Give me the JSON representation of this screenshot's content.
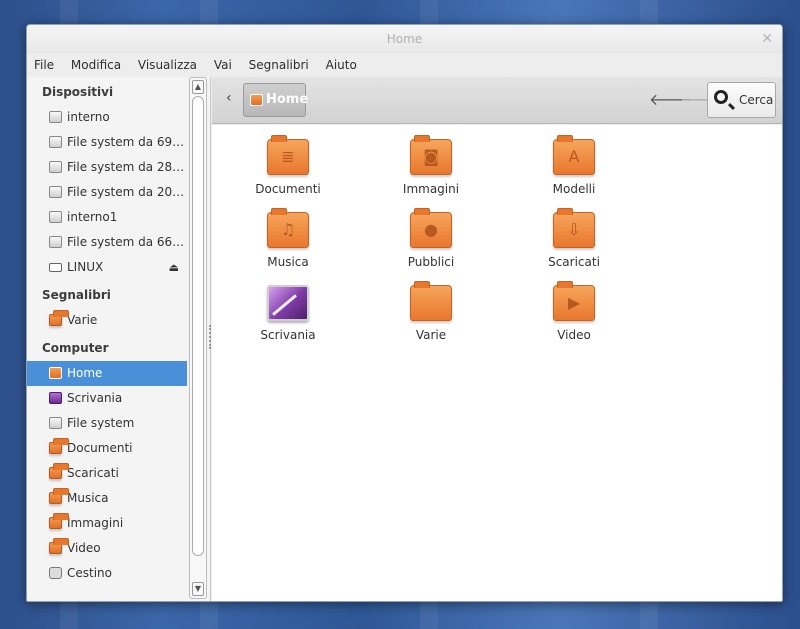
{
  "window": {
    "title": "Home"
  },
  "menu": [
    "File",
    "Modifica",
    "Visualizza",
    "Vai",
    "Segnalibri",
    "Aiuto"
  ],
  "sidebar": {
    "devices_title": "Dispositivi",
    "devices": [
      {
        "label": "interno",
        "icon": "drive-icon"
      },
      {
        "label": "File system da 69 ...",
        "icon": "drive-icon"
      },
      {
        "label": "File system da 28 ...",
        "icon": "drive-icon"
      },
      {
        "label": "File system da 20 ...",
        "icon": "drive-icon"
      },
      {
        "label": "interno1",
        "icon": "drive-icon"
      },
      {
        "label": "File system da 66 ...",
        "icon": "drive-icon"
      },
      {
        "label": "LINUX",
        "icon": "laptop-icon",
        "eject": "⏏"
      }
    ],
    "bookmarks_title": "Segnalibri",
    "bookmarks": [
      {
        "label": "Varie",
        "icon": "folder-icon"
      }
    ],
    "computer_title": "Computer",
    "computer": [
      {
        "label": "Home",
        "icon": "home-icon"
      },
      {
        "label": "Scrivania",
        "icon": "desktop-icon"
      },
      {
        "label": "File system",
        "icon": "drive-icon"
      },
      {
        "label": "Documenti",
        "icon": "folder-icon"
      },
      {
        "label": "Scaricati",
        "icon": "folder-icon"
      },
      {
        "label": "Musica",
        "icon": "folder-icon"
      },
      {
        "label": "Immagini",
        "icon": "folder-icon"
      },
      {
        "label": "Video",
        "icon": "folder-icon"
      },
      {
        "label": "Cestino",
        "icon": "trash-icon"
      }
    ]
  },
  "toolbar": {
    "back": "‹",
    "location": "Home",
    "prev": "🡐",
    "next": "🡒",
    "search_label": "Cerca"
  },
  "files": [
    {
      "label": "Documenti",
      "emblem": "≣"
    },
    {
      "label": "Immagini",
      "emblem": "◙"
    },
    {
      "label": "Modelli",
      "emblem": "A"
    },
    {
      "label": "Musica",
      "emblem": "♫"
    },
    {
      "label": "Pubblici",
      "emblem": "●"
    },
    {
      "label": "Scaricati",
      "emblem": "⇩"
    },
    {
      "label": "Scrivania",
      "emblem": ""
    },
    {
      "label": "Varie",
      "emblem": ""
    },
    {
      "label": "Video",
      "emblem": "▶"
    }
  ]
}
